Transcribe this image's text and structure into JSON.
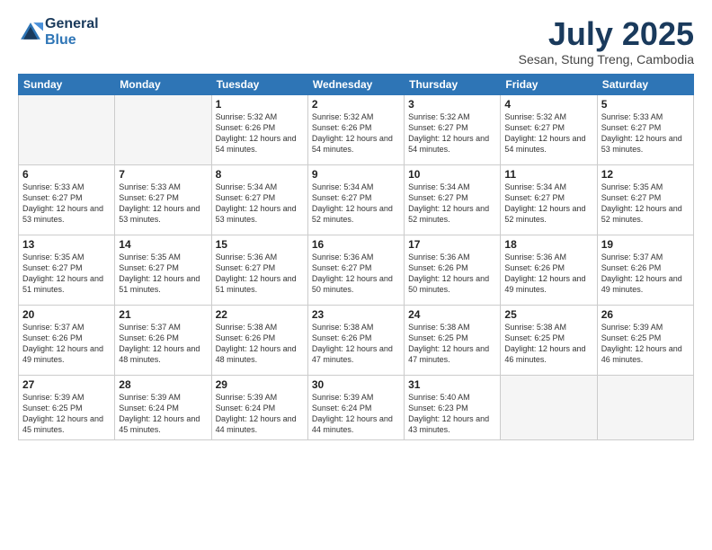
{
  "header": {
    "logo_line1": "General",
    "logo_line2": "Blue",
    "month_title": "July 2025",
    "subtitle": "Sesan, Stung Treng, Cambodia"
  },
  "days_of_week": [
    "Sunday",
    "Monday",
    "Tuesday",
    "Wednesday",
    "Thursday",
    "Friday",
    "Saturday"
  ],
  "weeks": [
    [
      {
        "day": "",
        "info": ""
      },
      {
        "day": "",
        "info": ""
      },
      {
        "day": "1",
        "info": "Sunrise: 5:32 AM\nSunset: 6:26 PM\nDaylight: 12 hours and 54 minutes."
      },
      {
        "day": "2",
        "info": "Sunrise: 5:32 AM\nSunset: 6:26 PM\nDaylight: 12 hours and 54 minutes."
      },
      {
        "day": "3",
        "info": "Sunrise: 5:32 AM\nSunset: 6:27 PM\nDaylight: 12 hours and 54 minutes."
      },
      {
        "day": "4",
        "info": "Sunrise: 5:32 AM\nSunset: 6:27 PM\nDaylight: 12 hours and 54 minutes."
      },
      {
        "day": "5",
        "info": "Sunrise: 5:33 AM\nSunset: 6:27 PM\nDaylight: 12 hours and 53 minutes."
      }
    ],
    [
      {
        "day": "6",
        "info": "Sunrise: 5:33 AM\nSunset: 6:27 PM\nDaylight: 12 hours and 53 minutes."
      },
      {
        "day": "7",
        "info": "Sunrise: 5:33 AM\nSunset: 6:27 PM\nDaylight: 12 hours and 53 minutes."
      },
      {
        "day": "8",
        "info": "Sunrise: 5:34 AM\nSunset: 6:27 PM\nDaylight: 12 hours and 53 minutes."
      },
      {
        "day": "9",
        "info": "Sunrise: 5:34 AM\nSunset: 6:27 PM\nDaylight: 12 hours and 52 minutes."
      },
      {
        "day": "10",
        "info": "Sunrise: 5:34 AM\nSunset: 6:27 PM\nDaylight: 12 hours and 52 minutes."
      },
      {
        "day": "11",
        "info": "Sunrise: 5:34 AM\nSunset: 6:27 PM\nDaylight: 12 hours and 52 minutes."
      },
      {
        "day": "12",
        "info": "Sunrise: 5:35 AM\nSunset: 6:27 PM\nDaylight: 12 hours and 52 minutes."
      }
    ],
    [
      {
        "day": "13",
        "info": "Sunrise: 5:35 AM\nSunset: 6:27 PM\nDaylight: 12 hours and 51 minutes."
      },
      {
        "day": "14",
        "info": "Sunrise: 5:35 AM\nSunset: 6:27 PM\nDaylight: 12 hours and 51 minutes."
      },
      {
        "day": "15",
        "info": "Sunrise: 5:36 AM\nSunset: 6:27 PM\nDaylight: 12 hours and 51 minutes."
      },
      {
        "day": "16",
        "info": "Sunrise: 5:36 AM\nSunset: 6:27 PM\nDaylight: 12 hours and 50 minutes."
      },
      {
        "day": "17",
        "info": "Sunrise: 5:36 AM\nSunset: 6:26 PM\nDaylight: 12 hours and 50 minutes."
      },
      {
        "day": "18",
        "info": "Sunrise: 5:36 AM\nSunset: 6:26 PM\nDaylight: 12 hours and 49 minutes."
      },
      {
        "day": "19",
        "info": "Sunrise: 5:37 AM\nSunset: 6:26 PM\nDaylight: 12 hours and 49 minutes."
      }
    ],
    [
      {
        "day": "20",
        "info": "Sunrise: 5:37 AM\nSunset: 6:26 PM\nDaylight: 12 hours and 49 minutes."
      },
      {
        "day": "21",
        "info": "Sunrise: 5:37 AM\nSunset: 6:26 PM\nDaylight: 12 hours and 48 minutes."
      },
      {
        "day": "22",
        "info": "Sunrise: 5:38 AM\nSunset: 6:26 PM\nDaylight: 12 hours and 48 minutes."
      },
      {
        "day": "23",
        "info": "Sunrise: 5:38 AM\nSunset: 6:26 PM\nDaylight: 12 hours and 47 minutes."
      },
      {
        "day": "24",
        "info": "Sunrise: 5:38 AM\nSunset: 6:25 PM\nDaylight: 12 hours and 47 minutes."
      },
      {
        "day": "25",
        "info": "Sunrise: 5:38 AM\nSunset: 6:25 PM\nDaylight: 12 hours and 46 minutes."
      },
      {
        "day": "26",
        "info": "Sunrise: 5:39 AM\nSunset: 6:25 PM\nDaylight: 12 hours and 46 minutes."
      }
    ],
    [
      {
        "day": "27",
        "info": "Sunrise: 5:39 AM\nSunset: 6:25 PM\nDaylight: 12 hours and 45 minutes."
      },
      {
        "day": "28",
        "info": "Sunrise: 5:39 AM\nSunset: 6:24 PM\nDaylight: 12 hours and 45 minutes."
      },
      {
        "day": "29",
        "info": "Sunrise: 5:39 AM\nSunset: 6:24 PM\nDaylight: 12 hours and 44 minutes."
      },
      {
        "day": "30",
        "info": "Sunrise: 5:39 AM\nSunset: 6:24 PM\nDaylight: 12 hours and 44 minutes."
      },
      {
        "day": "31",
        "info": "Sunrise: 5:40 AM\nSunset: 6:23 PM\nDaylight: 12 hours and 43 minutes."
      },
      {
        "day": "",
        "info": ""
      },
      {
        "day": "",
        "info": ""
      }
    ]
  ]
}
